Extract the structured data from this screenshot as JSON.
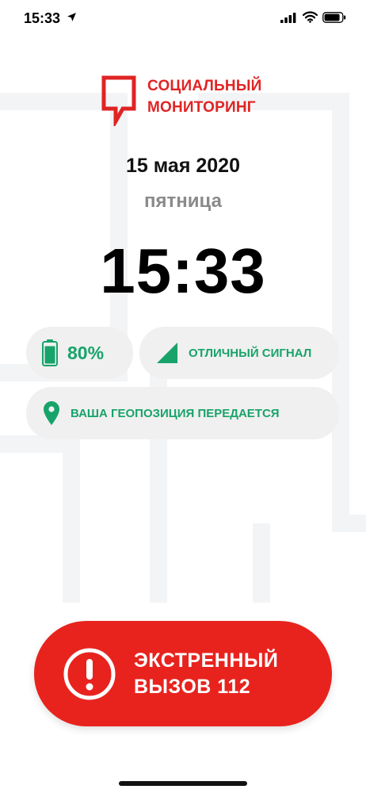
{
  "status_bar": {
    "time": "15:33"
  },
  "logo": {
    "line1": "СОЦИАЛЬНЫЙ",
    "line2": "МОНИТОРИНГ"
  },
  "date": "15 мая 2020",
  "weekday": "пятница",
  "clock": "15:33",
  "battery": {
    "percent_label": "80%",
    "level": 0.8
  },
  "signal": {
    "label": "ОТЛИЧНЫЙ СИГНАЛ"
  },
  "geo": {
    "label": "ВАША ГЕОПОЗИЦИЯ ПЕРЕДАЕТСЯ"
  },
  "emergency": {
    "line1": "ЭКСТРЕННЫЙ",
    "line2": "ВЫЗОВ 112"
  },
  "colors": {
    "brand_red": "#e02424",
    "accent_green": "#18a36a",
    "button_red": "#e8231e",
    "pill_bg": "#f0f0f0"
  }
}
